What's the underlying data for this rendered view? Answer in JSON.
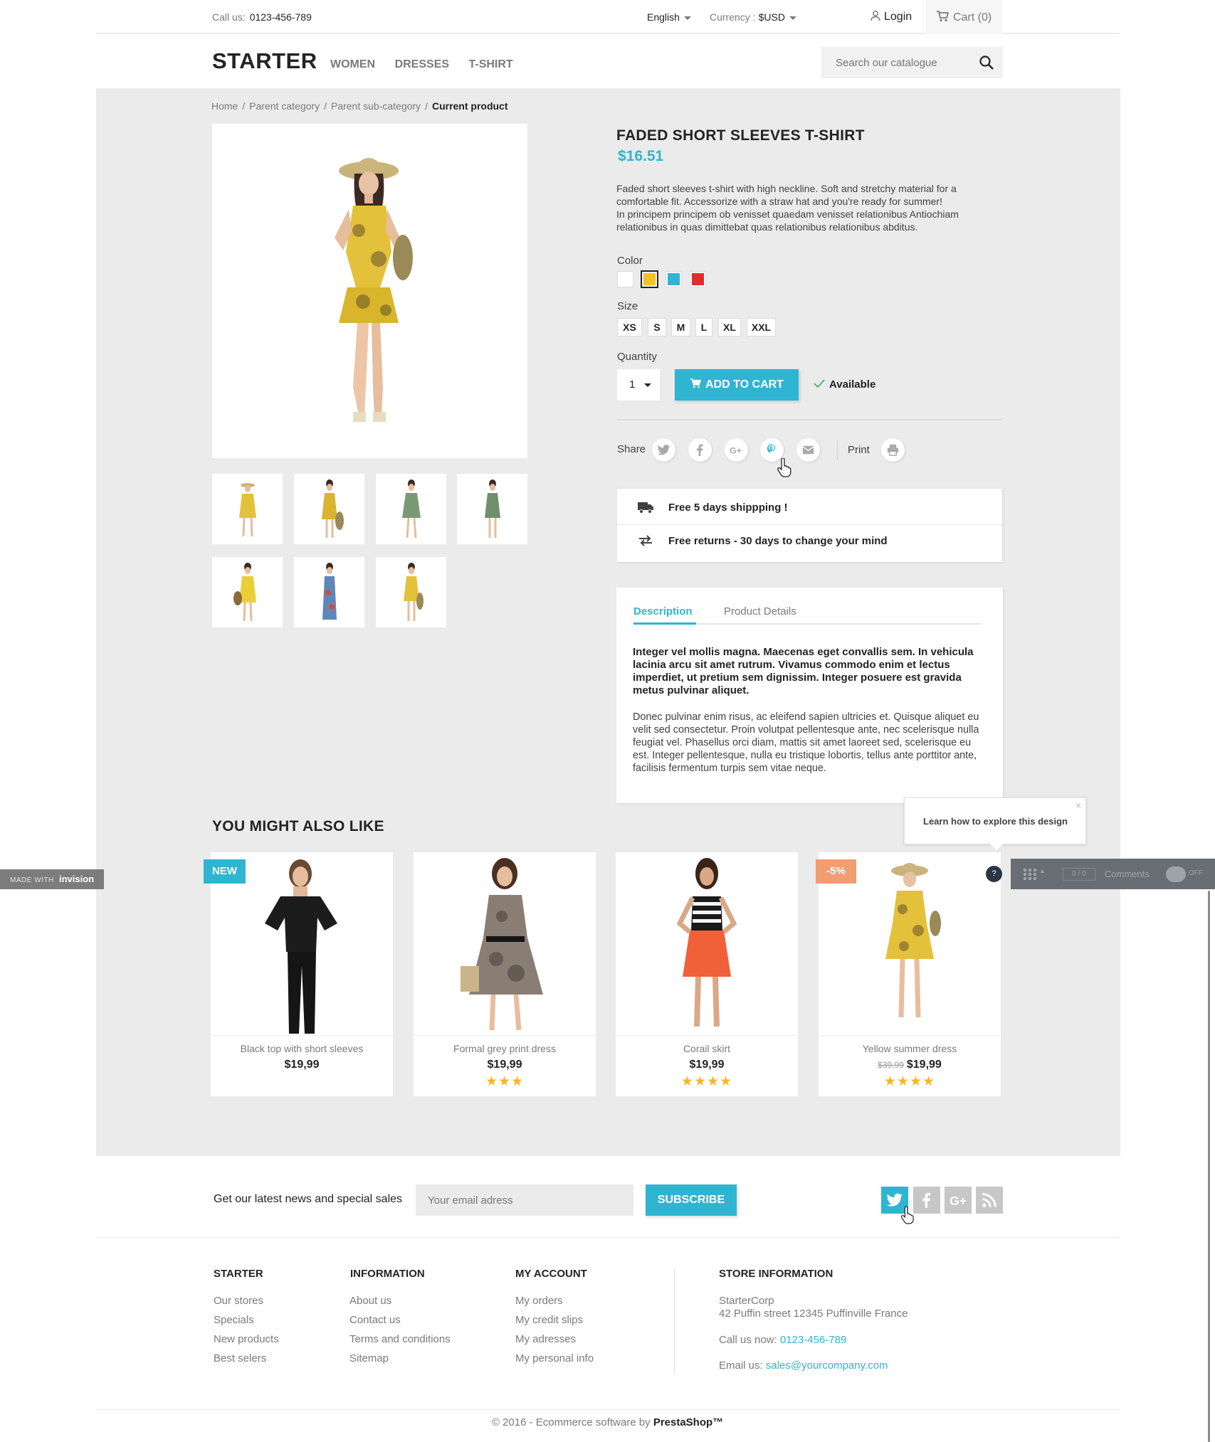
{
  "topbar": {
    "call_label": "Call us:",
    "phone": "0123-456-789",
    "language": "English",
    "currency_label": "Currency :",
    "currency_value": "$USD",
    "login": "Login",
    "cart": "Cart (0)"
  },
  "header": {
    "logo": "STARTER",
    "nav": [
      "WOMEN",
      "DRESSES",
      "T-SHIRT"
    ],
    "search_placeholder": "Search our catalogue"
  },
  "breadcrumb": [
    "Home",
    "Parent category",
    "Parent sub-category",
    "Current product"
  ],
  "product": {
    "title": "FADED SHORT SLEEVES T-SHIRT",
    "price": "$16.51",
    "description": "Faded short sleeves t-shirt with high neckline. Soft and stretchy material for a comfortable fit. Accessorize with a straw hat and you're ready for summer!\nIn principem principem ob venisset quaedam venisset relationibus Antiochiam relationibus in quas dimittebat quas relationibus relationibus abditus.",
    "color_label": "Color",
    "colors": [
      "#ffffff",
      "#f5c12a",
      "#2fb5d2",
      "#e02d2d"
    ],
    "size_label": "Size",
    "sizes": [
      "XS",
      "S",
      "M",
      "L",
      "XL",
      "XXL"
    ],
    "quantity_label": "Quantity",
    "quantity": "1",
    "add_to_cart": "ADD TO CART",
    "availability": "Available",
    "share_label": "Share",
    "print_label": "Print"
  },
  "reassurance": [
    "Free 5 days shippping !",
    "Free returns - 30 days to change your mind"
  ],
  "tabs": {
    "labels": [
      "Description",
      "Product Details"
    ],
    "description_bold": "Integer vel mollis magna. Maecenas eget convallis sem. In vehicula lacinia arcu sit amet rutrum. Vivamus commodo enim et lectus imperdiet, ut pretium sem dignissim. Integer posuere est gravida metus pulvinar aliquet.",
    "description_text": "Donec pulvinar enim risus, ac eleifend sapien ultricies et. Quisque aliquet eu velit sed consectetur. Proin volutpat pellentesque ante, nec scelerisque nulla feugiat vel. Phasellus orci diam, mattis sit amet laoreet sed, scelerisque eu est. Integer pellentesque, nulla eu tristique lobortis, tellus ante porttitor ante, facilisis fermentum turpis sem vitae neque."
  },
  "tooltip": "Learn how to explore this design",
  "related": {
    "title": "YOU MIGHT ALSO LIKE",
    "products": [
      {
        "name": "Black top with short sleeves",
        "price": "$19,99",
        "old_price": "",
        "stars": "",
        "flag": "NEW"
      },
      {
        "name": "Formal grey print dress",
        "price": "$19,99",
        "old_price": "",
        "stars": "★★★",
        "flag": ""
      },
      {
        "name": "Corail skirt",
        "price": "$19,99",
        "old_price": "",
        "stars": "★★★★",
        "flag": ""
      },
      {
        "name": "Yellow summer dress",
        "price": "$19,99",
        "old_price": "$39,99",
        "stars": "★★★★",
        "flag": "-5%"
      }
    ]
  },
  "invision": {
    "badge_made": "MADE WITH",
    "badge_brand": "invision",
    "counter_a": "0",
    "counter_b": "0",
    "comments": "Comments",
    "toggle": "OFF",
    "help": "?"
  },
  "newsletter": {
    "label": "Get our latest news and special sales",
    "placeholder": "Your email adress",
    "button": "SUBSCRIBE"
  },
  "footer": {
    "columns": [
      {
        "title": "STARTER",
        "links": [
          "Our stores",
          "Specials",
          "New products",
          "Best selers"
        ]
      },
      {
        "title": "INFORMATION",
        "links": [
          "About us",
          "Contact us",
          "Terms and conditions",
          "Sitemap"
        ]
      },
      {
        "title": "MY ACCOUNT",
        "links": [
          "My orders",
          "My credit slips",
          "My adresses",
          "My personal info"
        ]
      }
    ],
    "store": {
      "title": "STORE INFORMATION",
      "name": "StarterCorp",
      "address": "42 Puffin street 12345 Puffinville France",
      "call_label": "Call us now:",
      "phone": "0123-456-789",
      "email_label": "Email us:",
      "email": "sales@yourcompany.com"
    },
    "copyright_prefix": "© 2016 - Ecommerce software by",
    "copyright_brand": "PrestaShop™"
  },
  "colors": {
    "accent": "#2fb5d2",
    "sale": "#f39d72",
    "star": "#f8b723",
    "main_bg": "#ebebeb"
  }
}
